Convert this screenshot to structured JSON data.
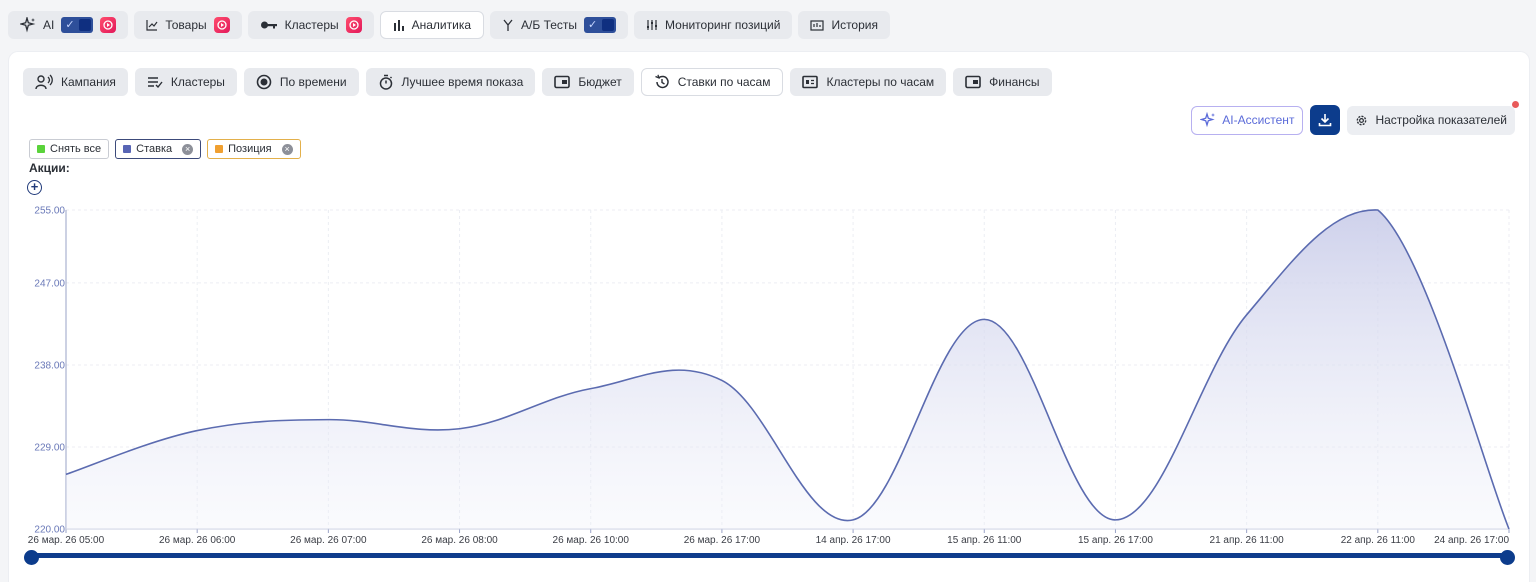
{
  "top_tabs": [
    {
      "label": "AI",
      "icon": "sparkle-icon",
      "toggle": true,
      "badge": true,
      "active": false
    },
    {
      "label": "Товары",
      "icon": "trend-chart-icon",
      "toggle": false,
      "badge": true,
      "active": false
    },
    {
      "label": "Кластеры",
      "icon": "key-icon",
      "toggle": false,
      "badge": true,
      "active": false
    },
    {
      "label": "Аналитика",
      "icon": "bar-chart-icon",
      "toggle": false,
      "badge": false,
      "active": true
    },
    {
      "label": "А/Б Тесты",
      "icon": "split-icon",
      "toggle": true,
      "badge": false,
      "active": false
    },
    {
      "label": "Мониторинг позиций",
      "icon": "sliders-icon",
      "toggle": false,
      "badge": false,
      "active": false
    },
    {
      "label": "История",
      "icon": "history-chart-icon",
      "toggle": false,
      "badge": false,
      "active": false
    }
  ],
  "sub_tabs": [
    {
      "label": "Кампания",
      "icon": "megaphone-icon",
      "active": false
    },
    {
      "label": "Кластеры",
      "icon": "list-check-icon",
      "active": false
    },
    {
      "label": "По времени",
      "icon": "clock-icon",
      "active": false
    },
    {
      "label": "Лучшее время показа",
      "icon": "stopwatch-icon",
      "active": false
    },
    {
      "label": "Бюджет",
      "icon": "wallet-icon",
      "active": false
    },
    {
      "label": "Ставки по часам",
      "icon": "history-icon",
      "active": true
    },
    {
      "label": "Кластеры по часам",
      "icon": "money-icon",
      "active": false
    },
    {
      "label": "Финансы",
      "icon": "wallet-icon",
      "active": false
    }
  ],
  "actions": {
    "ai_assistant": "AI-Ассистент",
    "settings": "Настройка показателей"
  },
  "legend": {
    "clear_all": "Снять все",
    "series_bid": "Ставка",
    "series_position": "Позиция"
  },
  "promo_label": "Акции:",
  "colors": {
    "accent": "#0c3c8c",
    "series_line": "#5b6bb0",
    "clear_all": "#5ad33a",
    "bid": "#5865b5",
    "position": "#f0a030"
  },
  "chart_data": {
    "type": "area",
    "categories": [
      "26 мар. 26 05:00",
      "26 мар. 26 06:00",
      "26 мар. 26 07:00",
      "26 мар. 26 08:00",
      "26 мар. 26 10:00",
      "26 мар. 26 17:00",
      "14 апр. 26 17:00",
      "15 апр. 26 11:00",
      "15 апр. 26 17:00",
      "21 апр. 26 11:00",
      "22 апр. 26 11:00",
      "24 апр. 26 17:00"
    ],
    "series": [
      {
        "name": "Ставка",
        "values": [
          226,
          230.8,
          232,
          231,
          235.4,
          236.3,
          221,
          243,
          221,
          243.5,
          255,
          220
        ]
      }
    ],
    "yticks": [
      "220.00",
      "229.00",
      "238.00",
      "247.00",
      "255.00"
    ],
    "ylim": [
      220,
      255
    ],
    "grid": true
  }
}
